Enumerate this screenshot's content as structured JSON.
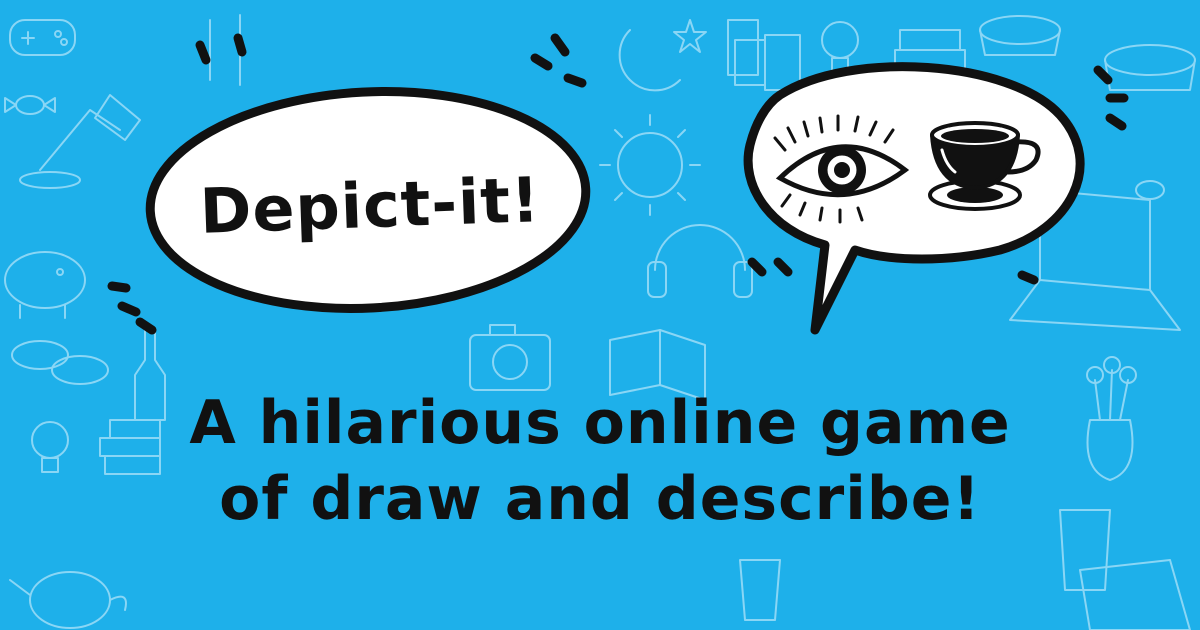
{
  "banner": {
    "title": "Depict-it!",
    "tagline_line1": "A hilarious online game",
    "tagline_line2": "of draw and describe!",
    "background_color": "#1eb0ea",
    "doodle_color": "#8ad6f5",
    "ink_color": "#111111",
    "bubble_fill": "#ffffff"
  },
  "icons": [
    "eye-icon",
    "teacup-icon",
    "sun-doodle",
    "moon-doodle",
    "camera-doodle",
    "headphones-doodle",
    "lamp-doodle",
    "lightbulb-doodle",
    "laptop-doodle",
    "piggy-bank-doodle",
    "cup-doodle",
    "vase-doodle"
  ]
}
